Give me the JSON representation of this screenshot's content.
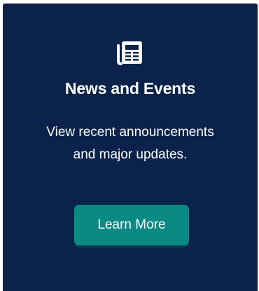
{
  "card": {
    "icon": "newspaper-icon",
    "title": "News and Events",
    "description_line1": "View recent announcements",
    "description_line2": "and major updates.",
    "button_label": "Learn More"
  },
  "colors": {
    "card_background": "#0b234a",
    "button_background": "#0b8a84",
    "text": "#ffffff"
  }
}
